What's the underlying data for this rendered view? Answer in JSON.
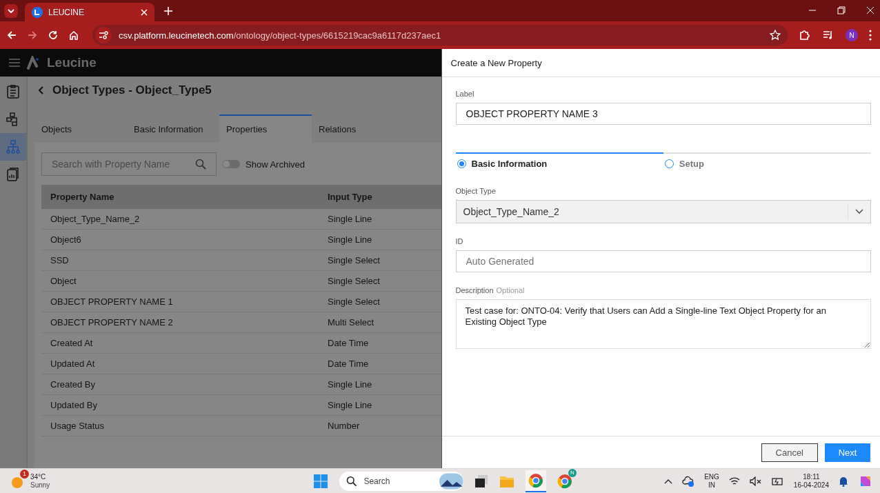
{
  "browser": {
    "tabs": [
      {
        "title": "LEUCINE",
        "selected": true
      }
    ],
    "url": {
      "domain": "csv.platform.leucinetech.com",
      "path": "/ontology/object-types/6615219cac9a6117d237aec1"
    },
    "profile": "N"
  },
  "app": {
    "brand": "Leucine",
    "sidebar": [
      {
        "selected": false
      },
      {
        "selected": false
      },
      {
        "selected": true
      },
      {
        "selected": false
      }
    ],
    "title": "Object Types - Object_Type5",
    "tabs": [
      {
        "label": "Objects",
        "selected": false
      },
      {
        "label": "Basic Information",
        "selected": false
      },
      {
        "label": "Properties",
        "selected": true
      },
      {
        "label": "Relations",
        "selected": false
      }
    ],
    "search": {
      "placeholder": "Search with Property Name"
    },
    "archived_toggle": {
      "label": "Show Archived",
      "on": false
    },
    "table": {
      "columns": [
        "Property Name",
        "Input Type"
      ],
      "rows": [
        [
          "Object_Type_Name_2",
          "Single Line"
        ],
        [
          "Object6",
          "Single Line"
        ],
        [
          "SSD",
          "Single Select"
        ],
        [
          "Object",
          "Single Select"
        ],
        [
          "OBJECT PROPERTY NAME 1",
          "Single Select"
        ],
        [
          "OBJECT PROPERTY NAME 2",
          "Multi Select"
        ],
        [
          "Created At",
          "Date Time"
        ],
        [
          "Updated At",
          "Date Time"
        ],
        [
          "Created By",
          "Single Line"
        ],
        [
          "Updated By",
          "Single Line"
        ],
        [
          "Usage Status",
          "Number"
        ]
      ]
    }
  },
  "drawer": {
    "title": "Create a New Property",
    "label_field": {
      "label": "Label",
      "value": "OBJECT PROPERTY NAME 3"
    },
    "steps": [
      {
        "label": "Basic Information",
        "selected": true
      },
      {
        "label": "Setup",
        "selected": false
      }
    ],
    "object_type": {
      "label": "Object Type",
      "value": "Object_Type_Name_2"
    },
    "id_field": {
      "label": "ID",
      "placeholder": "Auto Generated"
    },
    "description": {
      "label": "Description",
      "hint": "Optional",
      "value": "Test case for: ONTO-04: Verify that Users can Add a Single-line Text Object Property for an Existing Object Type"
    },
    "buttons": [
      {
        "label": "Cancel",
        "kind": "secondary"
      },
      {
        "label": "Next",
        "kind": "primary"
      }
    ]
  },
  "taskbar": {
    "weather": {
      "badge": "1",
      "temp": "34°C",
      "condition": "Sunny"
    },
    "search": {
      "placeholder": "Search"
    },
    "chrome_badge": "N",
    "language": [
      "ENG",
      "IN"
    ],
    "time": "18:11",
    "date": "16-04-2024"
  }
}
